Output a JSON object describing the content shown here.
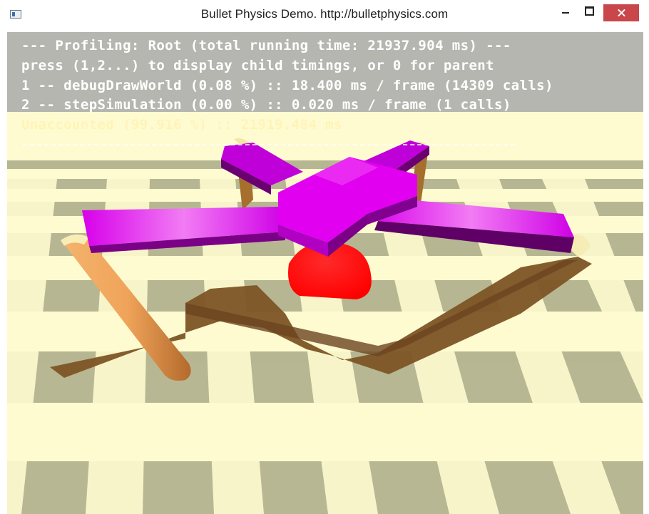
{
  "window": {
    "title": "Bullet Physics Demo. http://bulletphysics.com"
  },
  "profiler": {
    "line1": "--- Profiling: Root (total running time: 21937.904 ms) ---",
    "line2": "press (1,2...) to display child timings, or 0 for parent",
    "line3": "1 -- debugDrawWorld (0.08 %) :: 18.400 ms / frame (14309 calls)",
    "line4": "2 -- stepSimulation (0.00 %) :: 0.020 ms / frame (1 calls)",
    "line5": "Unaccounted (99.916 %) :: 21919.484 ms"
  },
  "colors": {
    "floor_light": "#fffbd0",
    "floor_dark": "#b3b48f",
    "shadow": "#7d5426",
    "body_magenta": "#e100f0",
    "leg_orange": "#f2a35c",
    "sphere_red": "#ff0000"
  },
  "icons": {
    "app": "window-app-icon",
    "minimize": "minimize-icon",
    "maximize": "maximize-icon",
    "close": "close-icon"
  }
}
